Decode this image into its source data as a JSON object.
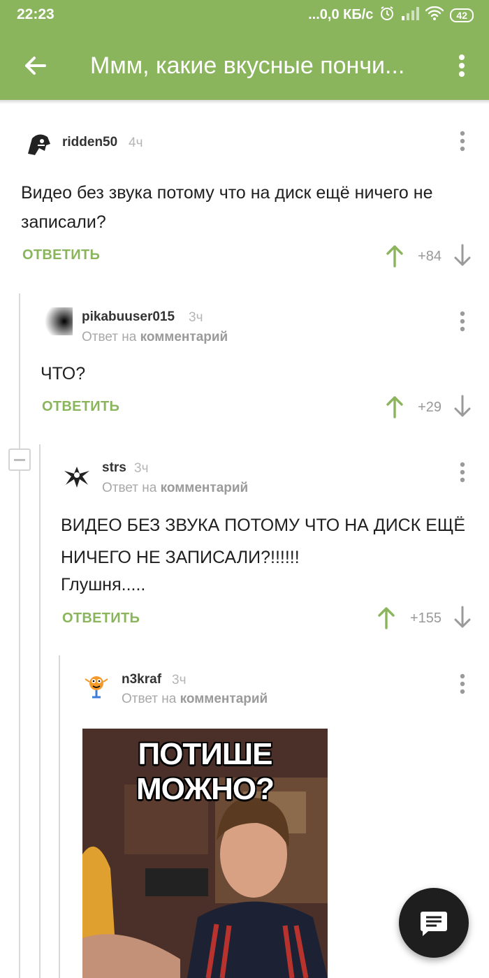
{
  "status_bar": {
    "time": "22:23",
    "network_speed": "...0,0 КБ/с",
    "battery": "42"
  },
  "toolbar": {
    "title": "Ммм, какие вкусные пончи..."
  },
  "comments": [
    {
      "username": "ridden50",
      "time": "4ч",
      "text": "Видео без звука потому что на диск ещё ничего не записали?",
      "reply_label": "ОТВЕТИТЬ",
      "score": "+84"
    },
    {
      "username": "pikabuuser015",
      "time": "3ч",
      "reply_prefix": "Ответ на ",
      "reply_target": "комментарий",
      "text": "ЧТО?",
      "reply_label": "ОТВЕТИТЬ",
      "score": "+29"
    },
    {
      "username": "strs",
      "time": "3ч",
      "reply_prefix": "Ответ на ",
      "reply_target": "комментарий",
      "text_line1": "ВИДЕО БЕЗ ЗВУКА ПОТОМУ ЧТО НА ДИСК ЕЩЁ НИЧЕГО НЕ ЗАПИСАЛИ?!!!!!!",
      "text_line2": "Глушня.....",
      "reply_label": "ОТВЕТИТЬ",
      "score": "+155"
    },
    {
      "username": "n3kraf",
      "time": "3ч",
      "reply_prefix": "Ответ на ",
      "reply_target": "комментарий",
      "image_caption": "ПОТИШЕ МОЖНО?"
    }
  ],
  "icons": {
    "back": "arrow-left",
    "more": "vertical-dots",
    "upvote": "arrow-up",
    "downvote": "arrow-down",
    "collapse": "minus",
    "fab": "comment-icon"
  },
  "colors": {
    "accent": "#8ab55c",
    "fab": "#1e1e1e"
  }
}
